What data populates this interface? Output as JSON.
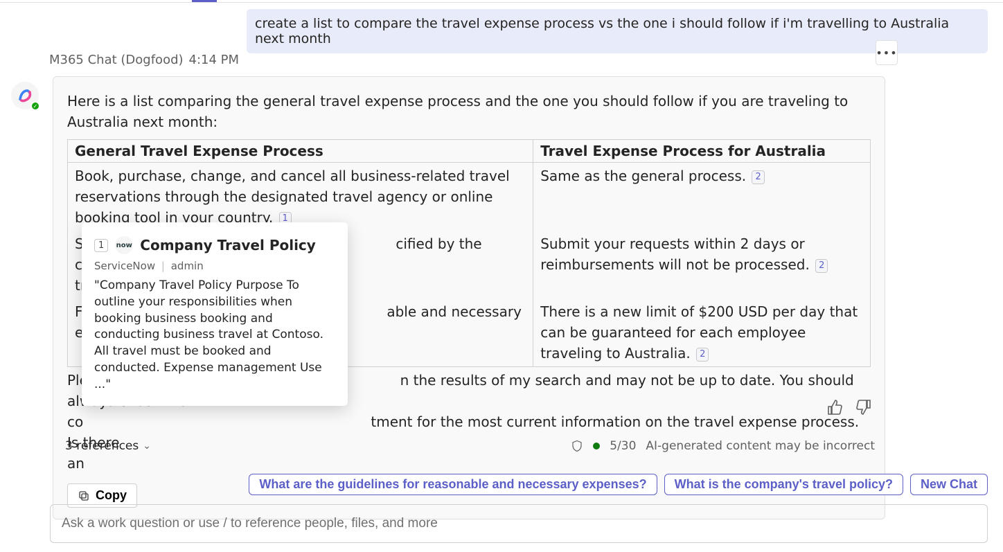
{
  "user_message": "create a list to compare the travel expense process vs the one i should follow if i'm travelling to Australia next month",
  "assistant": {
    "name": "M365 Chat (Dogfood)",
    "time": "4:14 PM"
  },
  "response": {
    "intro": "Here is a list comparing the general travel expense process and the one you should follow if you are traveling to Australia next month:",
    "table": {
      "headers": [
        "General Travel Expense Process",
        "Travel Expense Process for Australia"
      ],
      "rows": [
        {
          "left_text": "Book, purchase, change, and cancel all business-related travel reservations through the designated travel agency or online booking tool in your country.",
          "left_cite": "1",
          "right_text": "Same as the general process.",
          "right_cite": "2"
        },
        {
          "left_text_a": "S",
          "left_text_b": "cified by the company's",
          "left_text_c": "tr",
          "right_text": "Submit your requests within 2 days or reimbursements will not be processed.",
          "right_cite": "2"
        },
        {
          "left_text_a": "F",
          "left_text_b": "able and necessary",
          "left_text_c": "e",
          "right_text": "There is a new limit of $200 USD per day that can be guaranteed for each employee traveling to Australia.",
          "right_cite": "2"
        }
      ]
    },
    "disclaimer_a": "Ple",
    "disclaimer_b": "n the results of my search and may not be up to date. You should always check the",
    "disclaimer_c": "co",
    "disclaimer_d": "tment for the most current information on the travel expense process. Is there",
    "disclaimer_e": "an",
    "copy_label": "Copy"
  },
  "footer": {
    "references_label": "3 references",
    "counter": "5/30",
    "ai_notice": "AI-generated content may be incorrect"
  },
  "suggestions": [
    "What are the guidelines for reasonable and necessary expenses?",
    "What is the company's travel policy?",
    "New Chat"
  ],
  "compose_placeholder": "Ask a work question or use / to reference people, files, and more",
  "citation_card": {
    "number": "1",
    "logo_text": "now",
    "title": "Company Travel Policy",
    "source": "ServiceNow",
    "author": "admin",
    "snippet": "\"Company Travel Policy Purpose To outline your responsibilities when booking business booking and conducting business travel at Contoso. All travel must be booked and conducted. Expense management Use ...\""
  }
}
